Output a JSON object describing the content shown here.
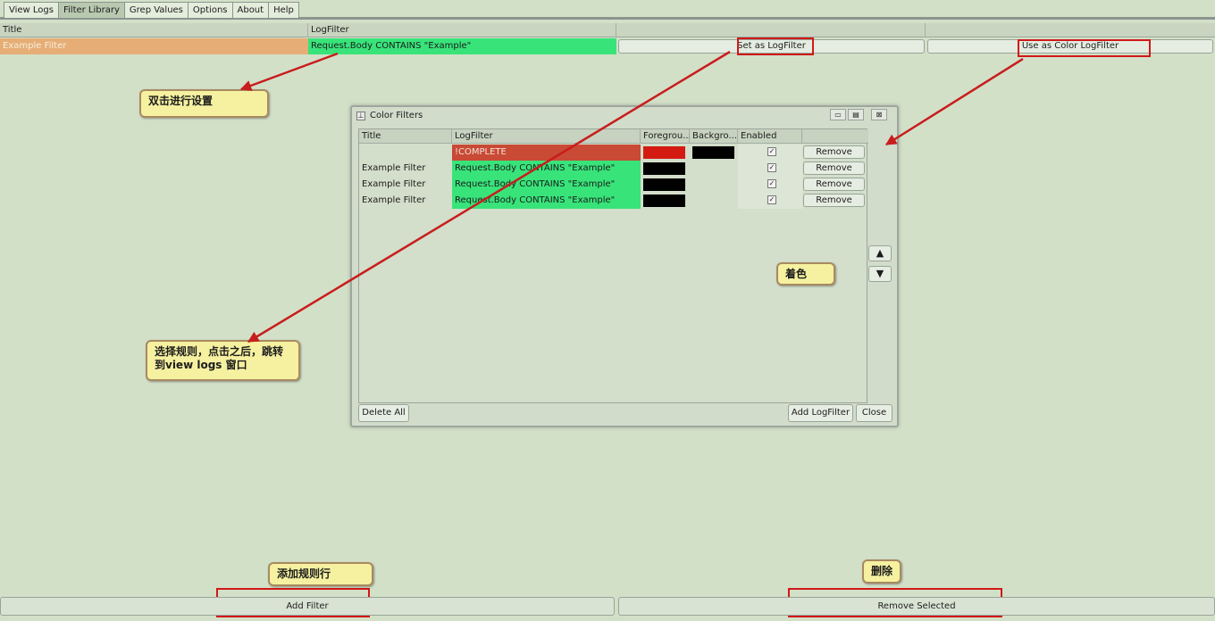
{
  "tabs": [
    "View Logs",
    "Filter Library",
    "Grep Values",
    "Options",
    "About",
    "Help"
  ],
  "active_tab": "Filter Library",
  "main_table": {
    "columns": [
      "Title",
      "LogFilter",
      "",
      ""
    ],
    "row": {
      "title": "Example Filter",
      "filter": "Request.Body CONTAINS \"Example\"",
      "set_button": "Set as LogFilter",
      "color_button": "Use as Color LogFilter"
    }
  },
  "color_filters": {
    "title": "Color Filters",
    "controls": [
      "▭",
      "▤",
      "⊠"
    ],
    "columns": [
      "Title",
      "LogFilter",
      "Foregrou...",
      "Backgro...",
      "Enabled",
      ""
    ],
    "rows": [
      {
        "title": "",
        "filter": "!COMPLETE",
        "fg": "#d41b12",
        "bg": "#000000",
        "enabled": "✓",
        "remove": "Remove"
      },
      {
        "title": "Example Filter",
        "filter": "Request.Body CONTAINS \"Example\"",
        "fg": "#000000",
        "bg": "",
        "enabled": "✓",
        "remove": "Remove"
      },
      {
        "title": "Example Filter",
        "filter": "Request.Body CONTAINS \"Example\"",
        "fg": "#000000",
        "bg": "",
        "enabled": "✓",
        "remove": "Remove"
      },
      {
        "title": "Example Filter",
        "filter": "Request.Body CONTAINS \"Example\"",
        "fg": "#000000",
        "bg": "",
        "enabled": "✓",
        "remove": "Remove"
      }
    ],
    "up": "▲",
    "down": "▼",
    "delete_all": "Delete All",
    "add": "Add LogFilter",
    "close": "Close"
  },
  "callouts": {
    "double_click": "双击进行设置",
    "select_rule": "选择规则，点击之后，跳转到view logs 窗口",
    "coloring": "着色",
    "add_row": "添加规则行",
    "delete": "删除"
  },
  "bottom": {
    "add": "Add Filter",
    "remove": "Remove Selected"
  },
  "colors": {
    "background": "#d3e0c8",
    "row_title": "#e6ae76",
    "filter_green": "#38e47a",
    "complete_red": "#c94a35",
    "highlight_red": "#d11818",
    "callout": "#f5f1a0"
  }
}
